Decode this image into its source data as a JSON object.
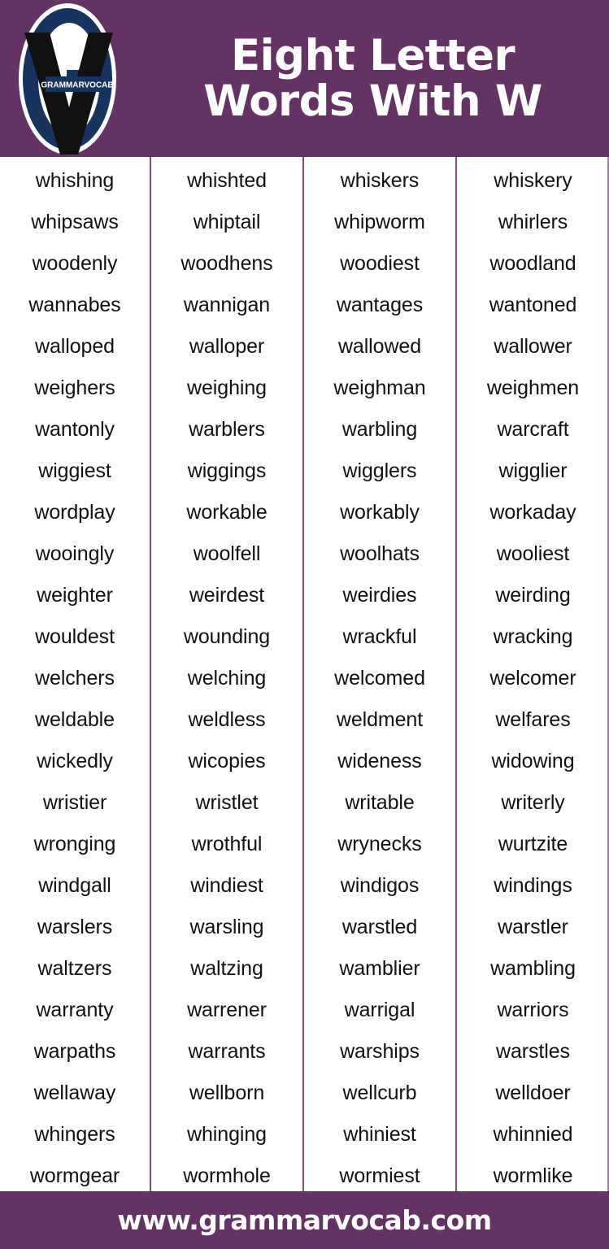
{
  "header": {
    "title_line1": "Eight Letter",
    "title_line2": "Words With W",
    "background_color": "#653264",
    "text_color": "#ffffff",
    "logo": {
      "name": "grammarvocab-logo",
      "badge_text": "GRAMMARVOCAB",
      "oval_color": "#19335f",
      "ring_color": "#ffffff",
      "v_color": "#111111"
    }
  },
  "footer": {
    "url": "www.grammarvocab.com",
    "background_color": "#653264",
    "text_color": "#ffffff"
  },
  "word_grid": {
    "divider_color": "#7e4d7e",
    "columns": 4,
    "rows": 25,
    "column1": [
      "whishing",
      "whipsaws",
      "woodenly",
      "wannabes",
      "walloped",
      "weighers",
      "wantonly",
      "wiggiest",
      "wordplay",
      "wooingly",
      "weighter",
      "wouldest",
      "welchers",
      "weldable",
      "wickedly",
      "wristier",
      "wronging",
      "windgall",
      "warslers",
      "waltzers",
      "warranty",
      "warpaths",
      "wellaway",
      "whingers",
      "wormgear"
    ],
    "column2": [
      "whishted",
      "whiptail",
      "woodhens",
      "wannigan",
      "walloper",
      "weighing",
      "warblers",
      "wiggings",
      "workable",
      "woolfell",
      "weirdest",
      "wounding",
      "welching",
      "weldless",
      "wicopies",
      "wristlet",
      "wrothful",
      "windiest",
      "warsling",
      "waltzing",
      "warrener",
      "warrants",
      "wellborn",
      "whinging",
      "wormhole"
    ],
    "column3": [
      "whiskers",
      "whipworm",
      "woodiest",
      "wantages",
      "wallowed",
      "weighman",
      "warbling",
      "wigglers",
      "workably",
      "woolhats",
      "weirdies",
      "wrackful",
      "welcomed",
      "weldment",
      "wideness",
      "writable",
      "wrynecks",
      "windigos",
      "warstled",
      "wamblier",
      "warrigal",
      "warships",
      "wellcurb",
      "whiniest",
      "wormiest"
    ],
    "column4": [
      "whiskery",
      "whirlers",
      "woodland",
      "wantoned",
      "wallower",
      "weighmen",
      "warcraft",
      "wigglier",
      "workaday",
      "wooliest",
      "weirding",
      "wracking",
      "welcomer",
      "welfares",
      "widowing",
      "writerly",
      "wurtzite",
      "windings",
      "warstler",
      "wambling",
      "warriors",
      "warstles",
      "welldoer",
      "whinnied",
      "wormlike"
    ]
  }
}
